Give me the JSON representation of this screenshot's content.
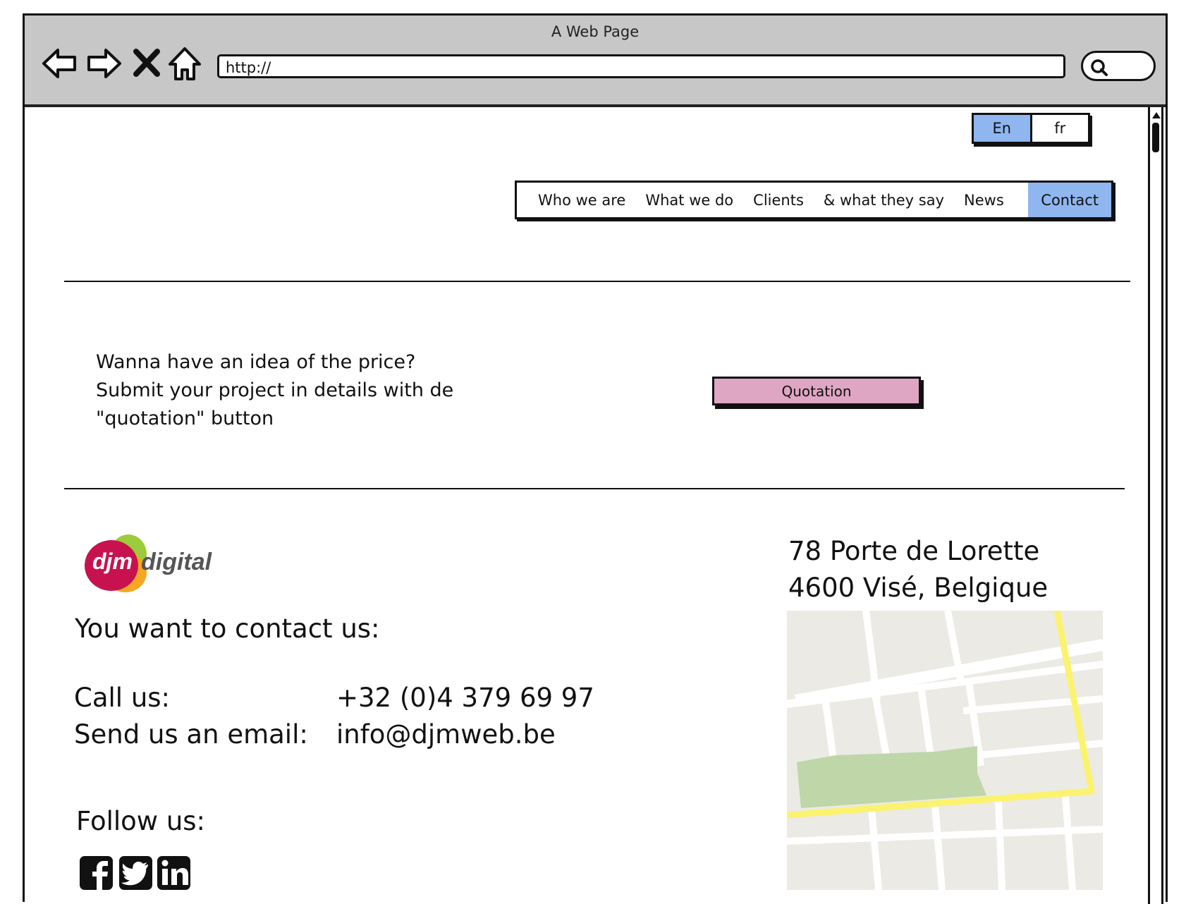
{
  "browser": {
    "title": "A Web Page",
    "url": "http://",
    "icons": [
      "back-arrow-icon",
      "forward-arrow-icon",
      "close-icon",
      "home-icon",
      "search-icon"
    ]
  },
  "language": {
    "options": [
      "En",
      "fr"
    ],
    "selected": "En"
  },
  "nav": {
    "items": [
      "Who we are",
      "What we do",
      "Clients",
      "& what they say",
      "News",
      "Contact"
    ],
    "active": "Contact"
  },
  "promo": {
    "lines": [
      "Wanna have an idea of the price?",
      "Submit your project in details with de",
      "\"quotation\" button"
    ],
    "button_label": "Quotation"
  },
  "logo": {
    "brand": "djm",
    "word": "digital"
  },
  "contact": {
    "heading": "You want to contact us:",
    "call_label": "Call us:",
    "phone": "+32 (0)4 379 69 97",
    "email_label": "Send us an email:",
    "email": "info@djmweb.be",
    "follow_label": "Follow us:",
    "social": [
      "facebook-icon",
      "twitter-icon",
      "linkedin-icon"
    ]
  },
  "address": {
    "line1": "78 Porte de Lorette",
    "line2": "4600 Visé, Belgique"
  },
  "colors": {
    "active_blue": "#8fb6ef",
    "button_pink": "#dfa6c3",
    "chrome_gray": "#c7c7c7",
    "map_road_yellow": "#fbf36d",
    "map_park_green": "#bed6a8"
  }
}
